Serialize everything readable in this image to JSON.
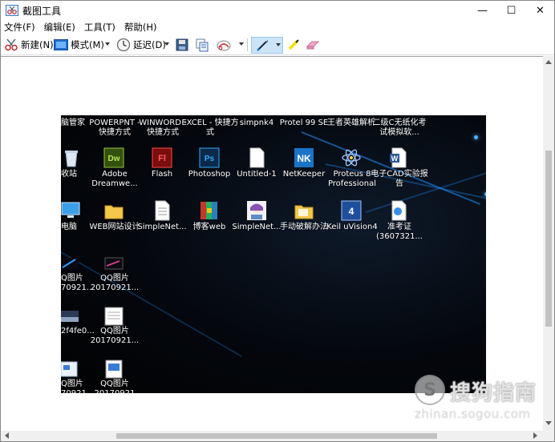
{
  "window": {
    "title": "截图工具",
    "controls": {
      "minimize": "—",
      "maximize": "☐",
      "close": "✕"
    }
  },
  "menu": [
    {
      "label": "文件(F)"
    },
    {
      "label": "编辑(E)"
    },
    {
      "label": "工具(T)"
    },
    {
      "label": "帮助(H)"
    }
  ],
  "toolbar": {
    "new_label": "新建(N)",
    "mode_label": "模式(M)",
    "delay_label": "延迟(D)",
    "icons": {
      "new": "scissors-icon",
      "mode": "mode-rect-icon",
      "delay": "clock-icon",
      "save": "floppy-icon",
      "copy": "copy-icon",
      "send": "send-icon",
      "pen": "pen-icon",
      "highlighter": "highlighter-icon",
      "eraser": "eraser-icon"
    }
  },
  "colors": {
    "desktop_bg": "#04070d",
    "accent_streak": "#1e90ff",
    "selected_tool": "#cce4f7"
  },
  "desktop": {
    "row1": [
      {
        "label": "脑管家"
      },
      {
        "label": "POWERPNT - 快捷方式"
      },
      {
        "label": "WINWORD - 快捷方式"
      },
      {
        "label": "EXCEL - 快捷方式"
      },
      {
        "label": "simpnk4"
      },
      {
        "label": "Protel 99 SE"
      },
      {
        "label": "王者英雄解析"
      },
      {
        "label": "二级C无纸化考试模拟软..."
      }
    ],
    "row2": [
      {
        "label": "收站"
      },
      {
        "label": "Adobe Dreamwe..."
      },
      {
        "label": "Flash"
      },
      {
        "label": "Photoshop"
      },
      {
        "label": "Untitled-1"
      },
      {
        "label": "NetKeeper"
      },
      {
        "label": "Proteus 8 Professional"
      },
      {
        "label": "电子CAD实验报告"
      }
    ],
    "row3": [
      {
        "label": "电脑"
      },
      {
        "label": "WEB网站设计"
      },
      {
        "label": "SimpleNet..."
      },
      {
        "label": "博客web"
      },
      {
        "label": "SimpleNet..."
      },
      {
        "label": "手动破解办法"
      },
      {
        "label": "Keil uVision4"
      },
      {
        "label": "准考证(3607321..."
      }
    ],
    "row4": [
      {
        "label": "Q图片 70921..."
      },
      {
        "label": "QQ图片 20170921..."
      }
    ],
    "row5": [
      {
        "label": "2f4fe0..."
      },
      {
        "label": "QQ图片 20170921..."
      }
    ],
    "row6": [
      {
        "label": "Q图片 70921"
      },
      {
        "label": "QQ图片 20170921"
      }
    ]
  },
  "watermark": {
    "logo_letter": "S",
    "brand": "搜狗指南",
    "url": "zhinan.sogou.com"
  }
}
